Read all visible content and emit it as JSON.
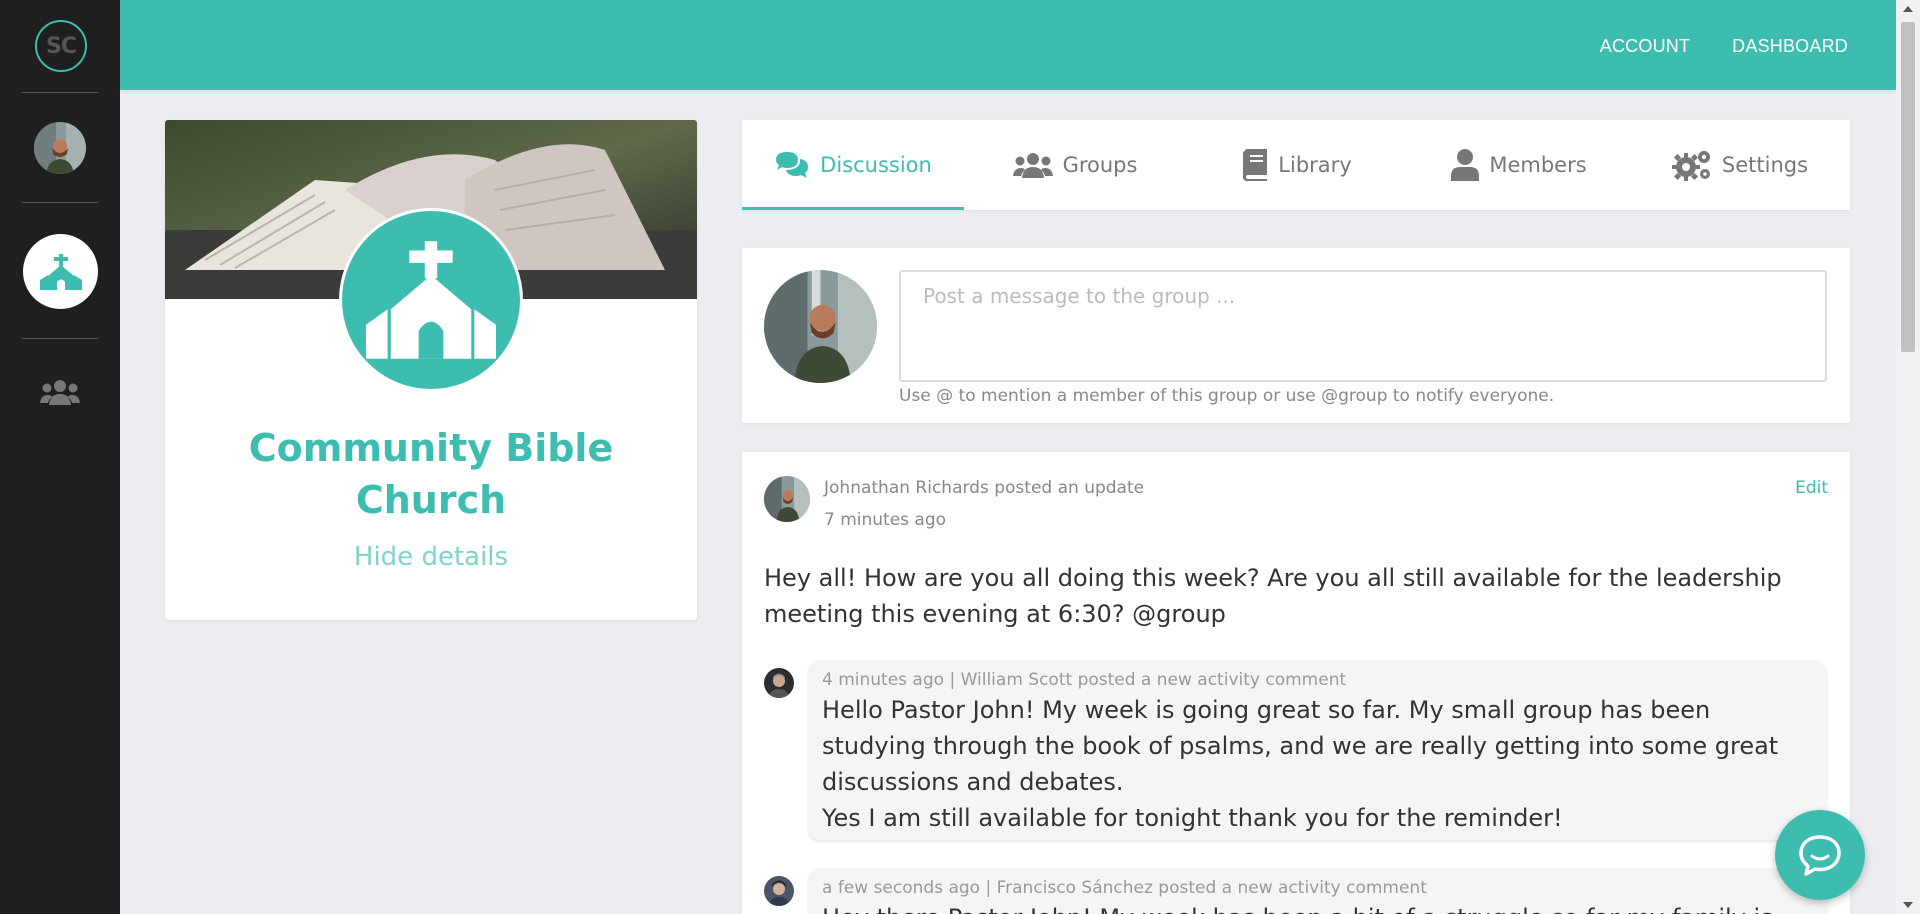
{
  "rail": {
    "logo_text": "SC",
    "items": [
      {
        "icon": "user-avatar"
      },
      {
        "icon": "church-icon",
        "active": true
      },
      {
        "icon": "users-icon"
      }
    ]
  },
  "topbar": {
    "nav": [
      "ACCOUNT",
      "DASHBOARD"
    ]
  },
  "group": {
    "name": "Community Bible Church",
    "toggle_label": "Hide details",
    "badge_icon": "church-icon"
  },
  "tabs": [
    {
      "label": "Discussion",
      "icon": "comments-icon",
      "active": true
    },
    {
      "label": "Groups",
      "icon": "users-icon",
      "active": false
    },
    {
      "label": "Library",
      "icon": "book-icon",
      "active": false
    },
    {
      "label": "Members",
      "icon": "user-icon",
      "active": false
    },
    {
      "label": "Settings",
      "icon": "gears-icon",
      "active": false
    }
  ],
  "composer": {
    "placeholder": "Post a message to the group ...",
    "hint": "Use @ to mention a member of this group or use @group to notify everyone."
  },
  "post": {
    "author_line": "Johnathan Richards posted an update",
    "time": "7 minutes ago",
    "edit_label": "Edit",
    "body": "Hey all! How are you all doing this week? Are you all still available for the leadership meeting this evening at 6:30? @group",
    "comments": [
      {
        "meta": "4 minutes ago | William Scott posted a new activity comment",
        "lines": [
          "Hello Pastor John! My week is going great so far. My small group has been studying through the book of psalms, and we are really getting into some great discussions and debates.",
          "Yes I am still available for tonight thank you for the reminder!"
        ]
      },
      {
        "meta": "a few seconds ago | Francisco Sánchez posted a new activity comment",
        "lines": [
          "Hey there Pastor John! My week has been a bit of a struggle so far my family is"
        ]
      }
    ]
  },
  "colors": {
    "brand": "#3dbdb0",
    "rail": "#1f1f1f",
    "page_bg": "#ebedf1"
  }
}
